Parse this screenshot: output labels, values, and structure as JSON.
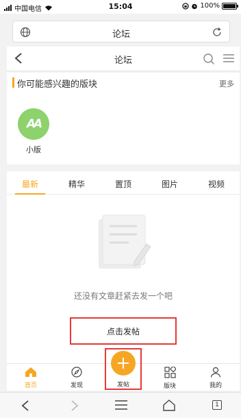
{
  "status_bar": {
    "carrier": "中国电信",
    "time": "15:04",
    "battery": "100%",
    "battery_level": 1.0
  },
  "url_bar": {
    "title": "论坛"
  },
  "nav": {
    "title": "论坛"
  },
  "section": {
    "title": "你可能感兴趣的版块",
    "more": "更多"
  },
  "forums": [
    {
      "label": "小版",
      "icon_text": "AA"
    }
  ],
  "tabs": [
    "最新",
    "精华",
    "置顶",
    "图片",
    "视频"
  ],
  "active_tab": "最新",
  "empty": {
    "message": "还没有文章赶紧去发一个吧",
    "button": "点击发帖"
  },
  "bottom_nav": [
    {
      "label": "首页",
      "icon": "home-icon"
    },
    {
      "label": "发现",
      "icon": "compass-icon"
    },
    {
      "label": "发帖",
      "icon": "plus-icon"
    },
    {
      "label": "版块",
      "icon": "grid-icon"
    },
    {
      "label": "我的",
      "icon": "user-icon"
    }
  ],
  "browser": {
    "tab_count": "1"
  },
  "colors": {
    "accent": "#f6a623",
    "highlight": "#e53935",
    "forum_icon": "#8dd26c"
  }
}
